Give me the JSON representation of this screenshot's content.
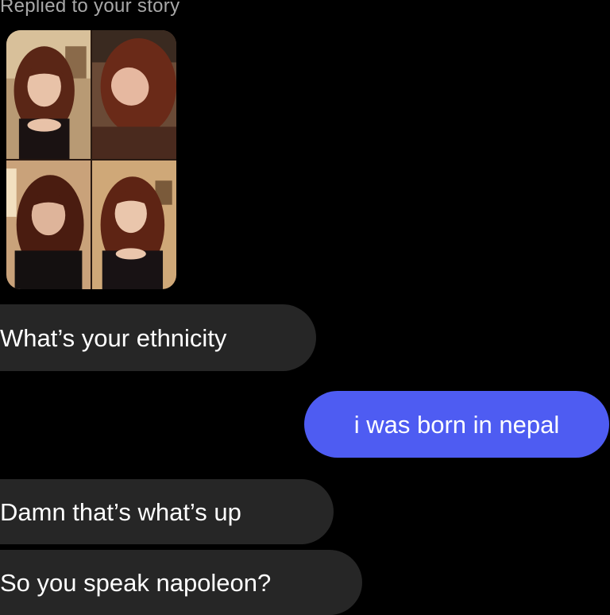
{
  "story_reply": {
    "label": "Replied to your story",
    "photos": [
      "selfie-photo-1",
      "selfie-photo-2",
      "selfie-photo-3",
      "selfie-photo-4"
    ]
  },
  "messages": [
    {
      "direction": "incoming",
      "text": "What’s your ethnicity"
    },
    {
      "direction": "outgoing",
      "text": "i was born in nepal"
    },
    {
      "direction": "incoming",
      "text": "Damn that’s what’s up"
    },
    {
      "direction": "incoming",
      "text": "So you speak napoleon?"
    }
  ],
  "colors": {
    "background": "#000000",
    "incoming_bubble": "#262626",
    "outgoing_bubble": "#4e5cf2",
    "label_gray": "#a8a8a8"
  }
}
